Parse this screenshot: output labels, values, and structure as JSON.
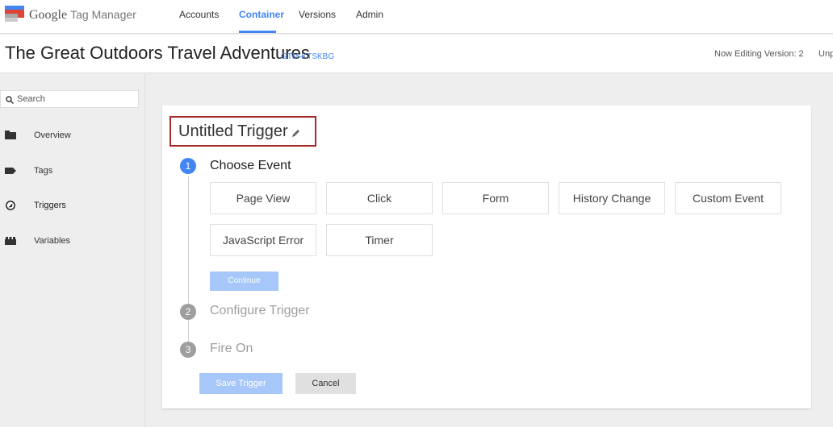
{
  "app": {
    "brand": "Google",
    "product": "Tag Manager"
  },
  "nav": [
    {
      "label": "Accounts"
    },
    {
      "label": "Container"
    },
    {
      "label": "Versions"
    },
    {
      "label": "Admin"
    }
  ],
  "container": {
    "title": "The Great Outdoors Travel Adventures",
    "id": "GTM-KTSKBG",
    "version_text": "Now Editing Version: 2",
    "status_text": "Unp"
  },
  "sidebar": {
    "search_placeholder": "Search",
    "items": [
      {
        "label": "Overview",
        "icon": "folder-icon"
      },
      {
        "label": "Tags",
        "icon": "tag-icon"
      },
      {
        "label": "Triggers",
        "icon": "trigger-icon"
      },
      {
        "label": "Variables",
        "icon": "variables-icon"
      }
    ]
  },
  "trigger": {
    "title": "Untitled Trigger",
    "steps": [
      {
        "number": "1",
        "label": "Choose Event"
      },
      {
        "number": "2",
        "label": "Configure Trigger"
      },
      {
        "number": "3",
        "label": "Fire On"
      }
    ],
    "events": [
      "Page View",
      "Click",
      "Form",
      "History Change",
      "Custom Event",
      "JavaScript Error",
      "Timer"
    ],
    "continue_label": "Continue",
    "save_label": "Save Trigger",
    "cancel_label": "Cancel"
  },
  "colors": {
    "accent": "#4285f4",
    "highlight_border": "#a52a2a",
    "disabled_button": "#a7c7fa"
  }
}
